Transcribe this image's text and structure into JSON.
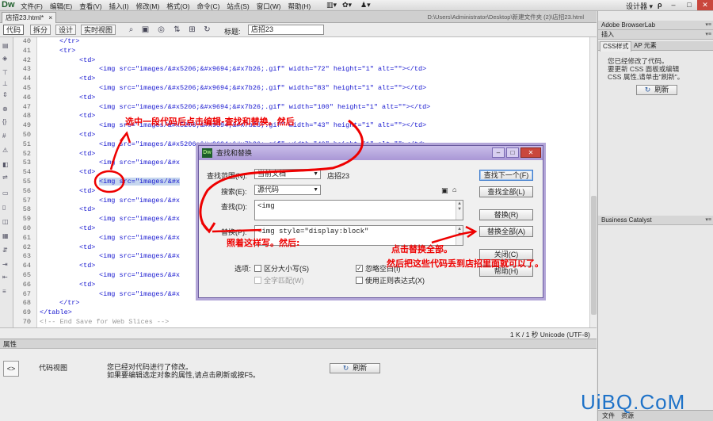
{
  "app": {
    "logo": "Dw",
    "menus": [
      "文件(F)",
      "编辑(E)",
      "查看(V)",
      "插入(I)",
      "修改(M)",
      "格式(O)",
      "命令(C)",
      "站点(S)",
      "窗口(W)",
      "帮助(H)"
    ],
    "workspace": "设计器 ▾",
    "search_icon_text": "ρ"
  },
  "document": {
    "tab_title": "店招23.html*",
    "tab_close": "×",
    "path": "D:\\Users\\Administrator\\Desktop\\新建文件夹 (2)\\店招23.html"
  },
  "toolbar": {
    "code": "代码",
    "split": "拆分",
    "design": "设计",
    "live": "实时视图",
    "title_label": "标题:",
    "title_value": "店招23"
  },
  "code_lines": [
    {
      "n": "40",
      "indent": 2,
      "text": "</tr>",
      "kind": "tag"
    },
    {
      "n": "41",
      "indent": 2,
      "text": "<tr>",
      "kind": "tag"
    },
    {
      "n": "42",
      "indent": 4,
      "text": "<td>",
      "kind": "tag"
    },
    {
      "n": "43",
      "indent": 6,
      "text": "<img src=\"images/&#x5206;&#x9694;&#x7b26;.gif\" width=\"72\" height=\"1\" alt=\"\"></td>",
      "kind": "tag"
    },
    {
      "n": "44",
      "indent": 4,
      "text": "<td>",
      "kind": "tag"
    },
    {
      "n": "45",
      "indent": 6,
      "text": "<img src=\"images/&#x5206;&#x9694;&#x7b26;.gif\" width=\"83\" height=\"1\" alt=\"\"></td>",
      "kind": "tag"
    },
    {
      "n": "46",
      "indent": 4,
      "text": "<td>",
      "kind": "tag"
    },
    {
      "n": "47",
      "indent": 6,
      "text": "<img src=\"images/&#x5206;&#x9694;&#x7b26;.gif\" width=\"100\" height=\"1\" alt=\"\"></td>",
      "kind": "tag"
    },
    {
      "n": "48",
      "indent": 4,
      "text": "<td>",
      "kind": "tag"
    },
    {
      "n": "49",
      "indent": 6,
      "text": "<img src=\"images/&#x5206;&#x9694;&#x7b26;.gif\" width=\"43\" height=\"1\" alt=\"\"></td>",
      "kind": "tag"
    },
    {
      "n": "50",
      "indent": 4,
      "text": "<td>",
      "kind": "tag"
    },
    {
      "n": "51",
      "indent": 6,
      "text": "<img src=\"images/&#x5206;&#x9694;&#x7b26;.gif\" width=\"40\" height=\"1\" alt=\"\"></td>",
      "kind": "tag"
    },
    {
      "n": "52",
      "indent": 4,
      "text": "<td>",
      "kind": "tag"
    },
    {
      "n": "53",
      "indent": 6,
      "text": "<img src=\"images/&#x",
      "kind": "tag"
    },
    {
      "n": "54",
      "indent": 4,
      "text": "<td>",
      "kind": "tag"
    },
    {
      "n": "55",
      "indent": 6,
      "text": "<img src=\"images/&#x",
      "kind": "tag",
      "highlight": true
    },
    {
      "n": "56",
      "indent": 4,
      "text": "<td>",
      "kind": "tag"
    },
    {
      "n": "57",
      "indent": 6,
      "text": "<img src=\"images/&#x",
      "kind": "tag"
    },
    {
      "n": "58",
      "indent": 4,
      "text": "<td>",
      "kind": "tag"
    },
    {
      "n": "59",
      "indent": 6,
      "text": "<img src=\"images/&#x",
      "kind": "tag"
    },
    {
      "n": "60",
      "indent": 4,
      "text": "<td>",
      "kind": "tag"
    },
    {
      "n": "61",
      "indent": 6,
      "text": "<img src=\"images/&#x",
      "kind": "tag"
    },
    {
      "n": "62",
      "indent": 4,
      "text": "<td>",
      "kind": "tag"
    },
    {
      "n": "63",
      "indent": 6,
      "text": "<img src=\"images/&#x",
      "kind": "tag"
    },
    {
      "n": "64",
      "indent": 4,
      "text": "<td>",
      "kind": "tag"
    },
    {
      "n": "65",
      "indent": 6,
      "text": "<img src=\"images/&#x",
      "kind": "tag"
    },
    {
      "n": "66",
      "indent": 4,
      "text": "<td>",
      "kind": "tag"
    },
    {
      "n": "67",
      "indent": 6,
      "text": "<img src=\"images/&#x",
      "kind": "tag"
    },
    {
      "n": "68",
      "indent": 2,
      "text": "</tr>",
      "kind": "tag"
    },
    {
      "n": "69",
      "indent": 0,
      "text": "</table>",
      "kind": "tag"
    },
    {
      "n": "70",
      "indent": 0,
      "text": "<!-- End Save for Web Slices -->",
      "kind": "comment"
    }
  ],
  "status": {
    "info": "1 K / 1 秒 Unicode (UTF-8)"
  },
  "properties": {
    "title": "属性",
    "view_label": "代码视图",
    "msg1": "您已经对代码进行了修改。",
    "msg2": "如果要编辑选定对象的属性,请点击刷新或按F5。",
    "refresh": "刷新"
  },
  "right_panel": {
    "browserlab": "Adobe BrowserLab",
    "insert": "插入",
    "css_tab": "CSS样式",
    "ap_tab": "AP 元素",
    "message": "您已经修改了代码。\n要更新 CSS 面板或编辑\nCSS 属性,请单击\"刷新\"。",
    "refresh": "刷新",
    "business_catalyst": "Business Catalyst",
    "files_tab": "文件",
    "assets_tab": "资源"
  },
  "dialog": {
    "title": "查找和替换",
    "scope_label": "查找范围(N):",
    "scope_value": "当前文档",
    "scope_doc": "店招23",
    "search_label": "搜索(E):",
    "search_value": "源代码",
    "find_label": "查找(D):",
    "find_value": "<img",
    "replace_label": "替换(P):",
    "replace_value": "<img style=\"display:block\"",
    "options_label": "选项:",
    "opt_case": "区分大小写(S)",
    "opt_ignore_ws": "忽略空白(I)",
    "opt_whole": "全字匹配(W)",
    "opt_regex": "使用正则表达式(X)",
    "btn_find_next": "查找下一个(F)",
    "btn_find_all": "查找全部(L)",
    "btn_replace": "替换(R)",
    "btn_replace_all": "替换全部(A)",
    "btn_close": "关闭(C)",
    "btn_help": "帮助(H)"
  },
  "annotations": {
    "a1": "选中一段代码后点击编辑-查找和替换。然后",
    "a2": "照着这样写。然后:",
    "a3": "点击替换全部。",
    "a4": "然后把这些代码丢到店招里面就可以了。"
  },
  "watermark": "UiBQ.CoM",
  "colors": {
    "code_blue": "#1818d0",
    "annotation_red": "#e00000",
    "watermark_blue": "#1e72c8",
    "dialog_border": "#6a5a9e"
  }
}
